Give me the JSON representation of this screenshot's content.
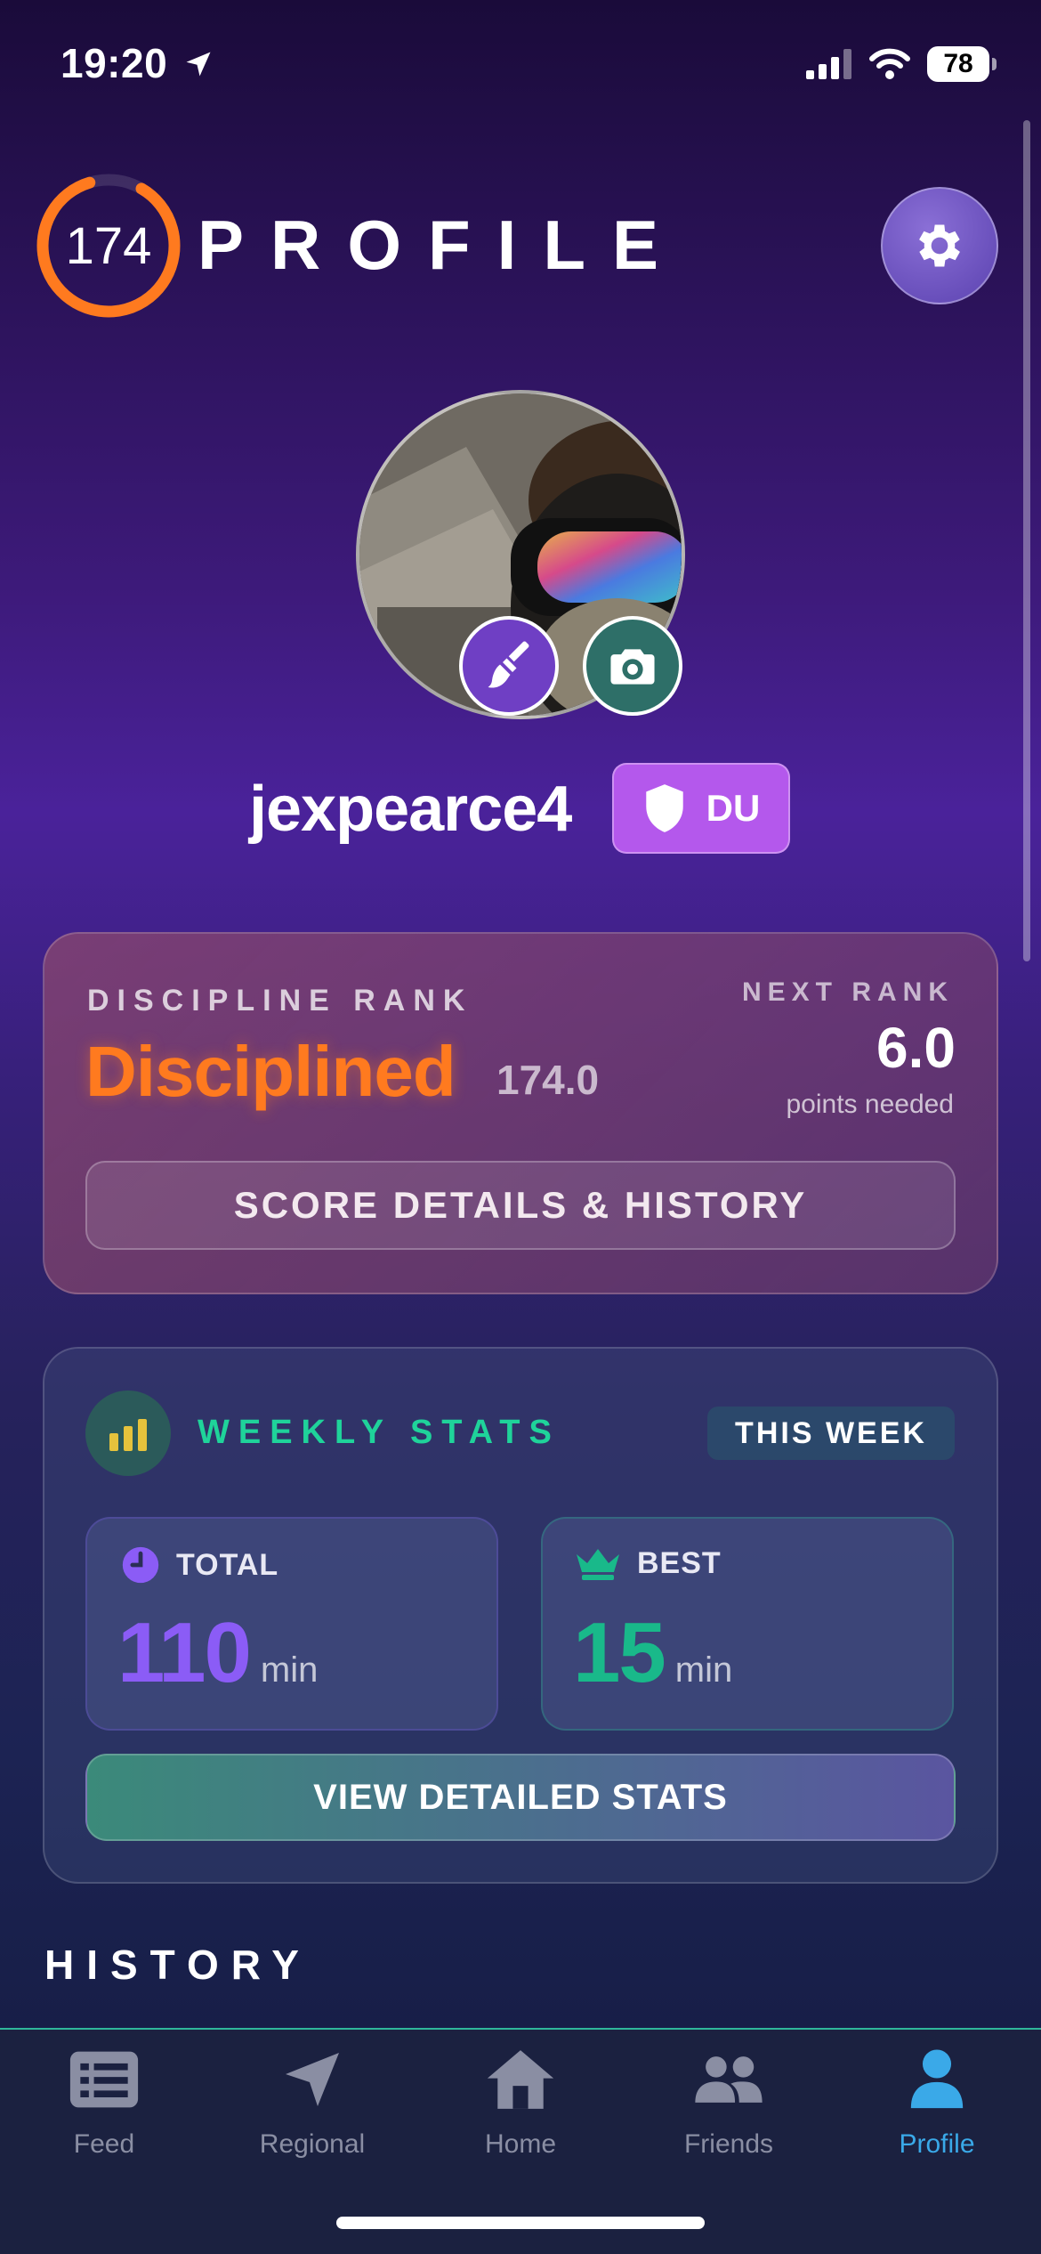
{
  "status_bar": {
    "time": "19:20",
    "battery": "78",
    "icons": [
      "location-arrow-icon",
      "signal-icon",
      "wifi-icon",
      "battery-icon"
    ]
  },
  "header": {
    "score": "174",
    "title": "PROFILE",
    "settings_icon": "gear-icon",
    "ring_progress": 0.87,
    "ring_color": "#ff7a1f"
  },
  "profile": {
    "username": "jexpearce4",
    "badge_text": "DU",
    "badge_icon": "shield-icon",
    "badge_color": "#b458ec",
    "avatar_buttons": [
      "paintbrush-icon",
      "camera-icon"
    ]
  },
  "rank_card": {
    "label": "DISCIPLINE RANK",
    "rank_name": "Disciplined",
    "rank_score": "174.0",
    "next_label": "NEXT RANK",
    "next_value": "6.0",
    "next_caption": "points needed",
    "button_label": "SCORE DETAILS & HISTORY",
    "rank_color": "#ff7a1f"
  },
  "weekly_stats": {
    "title": "WEEKLY STATS",
    "period": "THIS WEEK",
    "total": {
      "label": "TOTAL",
      "value": "110",
      "unit": "min",
      "icon": "clock-icon",
      "color": "#8b5cf6"
    },
    "best": {
      "label": "BEST",
      "value": "15",
      "unit": "min",
      "icon": "crown-icon",
      "color": "#19b98a"
    },
    "button_label": "VIEW DETAILED STATS"
  },
  "history": {
    "title": "HISTORY"
  },
  "tabs": [
    {
      "label": "Feed",
      "icon": "newspaper-icon",
      "active": false
    },
    {
      "label": "Regional",
      "icon": "navigation-arrow-icon",
      "active": false
    },
    {
      "label": "Home",
      "icon": "house-icon",
      "active": false
    },
    {
      "label": "Friends",
      "icon": "people-icon",
      "active": false
    },
    {
      "label": "Profile",
      "icon": "person-icon",
      "active": true
    }
  ],
  "colors": {
    "active_tab": "#3aa9e8",
    "accent_green": "#1fd39a"
  }
}
